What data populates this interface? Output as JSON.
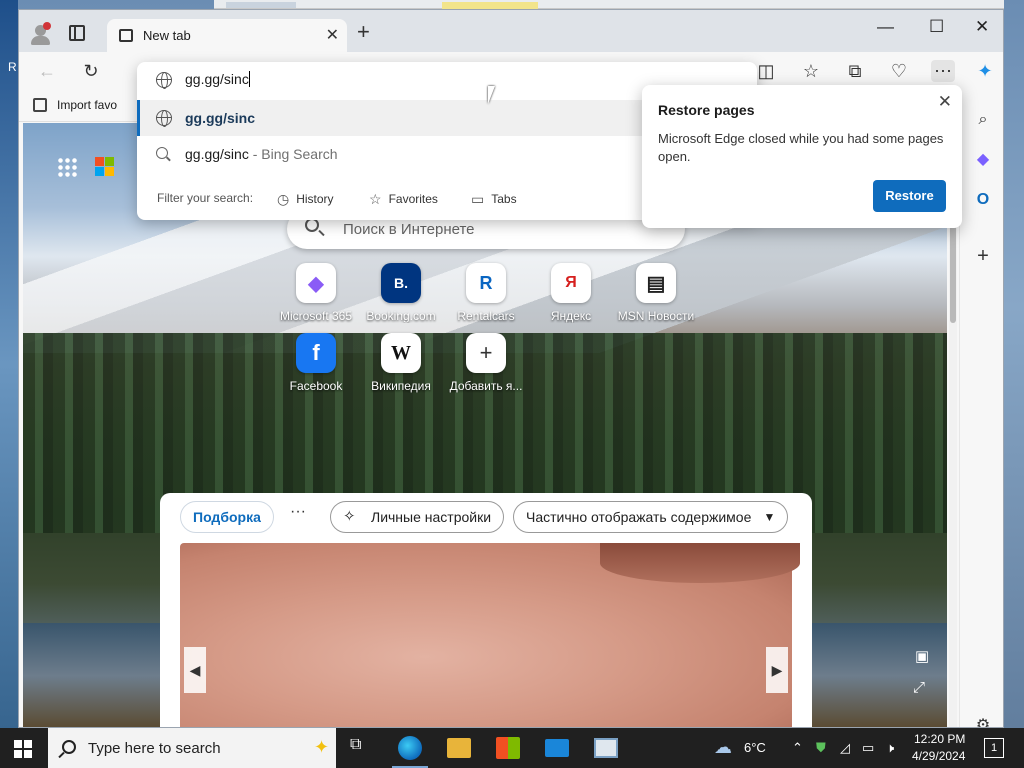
{
  "desktop": {
    "side_label": "R"
  },
  "browser": {
    "tab": {
      "title": "New tab"
    },
    "window_controls": {
      "minimize": "—",
      "maximize": "☐",
      "close": "✕"
    },
    "new_tab_glyph": "+",
    "favorites_bar": {
      "import_label": "Import favo"
    },
    "omnibox": {
      "value": "gg.gg/sinc",
      "suggestions": [
        {
          "text": "gg.gg/sinc",
          "suffix": "",
          "icon": "globe-icon"
        },
        {
          "text": "gg.gg/sinc",
          "suffix": " - Bing Search",
          "icon": "search-icon"
        }
      ],
      "filter_label": "Filter your search:",
      "filters": [
        {
          "label": "History",
          "icon": "history-icon"
        },
        {
          "label": "Favorites",
          "icon": "star-icon"
        },
        {
          "label": "Tabs",
          "icon": "tabs-icon"
        }
      ]
    },
    "restore_popup": {
      "title": "Restore pages",
      "message": "Microsoft Edge closed while you had some pages open.",
      "button": "Restore"
    }
  },
  "new_tab_page": {
    "search_placeholder": "Поиск в Интернете",
    "quick_links": [
      {
        "label": "Microsoft 365",
        "glyph": "◆",
        "color": "#8a5cf6"
      },
      {
        "label": "Booking.com",
        "glyph": "B.",
        "color": "#003580"
      },
      {
        "label": "Rentalcars",
        "glyph": "R",
        "color": "#0a66c2"
      },
      {
        "label": "Яндекс",
        "glyph": "Я",
        "color": "#d6201f"
      },
      {
        "label": "MSN Новости",
        "glyph": "▤",
        "color": "#222222"
      },
      {
        "label": "Facebook",
        "glyph": "f",
        "color": "#1877f2"
      },
      {
        "label": "Википедия",
        "glyph": "W",
        "color": "#111111"
      },
      {
        "label": "Добавить я...",
        "glyph": "+",
        "color": "#333333"
      }
    ],
    "feed": {
      "tab_active": "Подборка",
      "more": "···",
      "personalize": "Личные настройки",
      "content_mode": "Частично отображать содержимое"
    }
  },
  "taskbar": {
    "search_placeholder": "Type here to search",
    "weather": "6°C",
    "time": "12:20 PM",
    "date": "4/29/2024",
    "notification_count": "1"
  }
}
